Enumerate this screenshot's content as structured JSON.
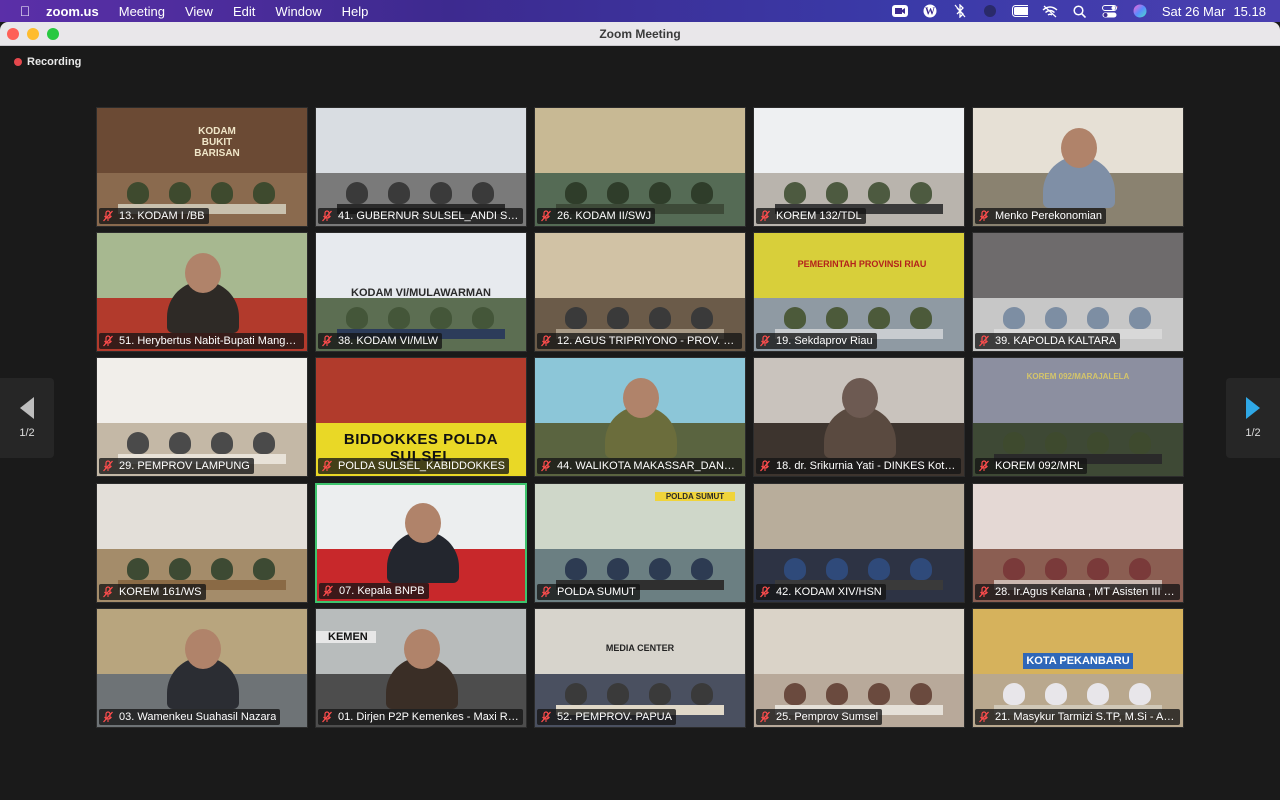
{
  "menubar": {
    "app_name": "zoom.us",
    "menus": [
      "Meeting",
      "View",
      "Edit",
      "Window",
      "Help"
    ],
    "date": "Sat 26 Mar",
    "time": "15.18",
    "icons": [
      "zoom-icon",
      "wordpress-icon",
      "bluetooth-off-icon",
      "status-icon",
      "battery-icon",
      "wifi-off-icon",
      "search-icon",
      "control-center-icon",
      "siri-icon"
    ]
  },
  "window": {
    "title": "Zoom Meeting"
  },
  "recording": {
    "label": "Recording"
  },
  "pager": {
    "left_label": "1/2",
    "right_label": "1/2"
  },
  "colors": {
    "active_speaker_border": "#3ec46d",
    "recording_dot": "#e5484d",
    "next_arrow": "#2fa8e6"
  },
  "participants": [
    {
      "name": "13. KODAM I /BB",
      "banner": "KODAM BUKIT BARISAN",
      "theme": "wood"
    },
    {
      "name": "41. GUBERNUR SULSEL_ANDI SUDI...",
      "banner": "",
      "theme": "flags"
    },
    {
      "name": "26. KODAM II/SWJ",
      "banner": "",
      "theme": "hall"
    },
    {
      "name": "KOREM 132/TDL",
      "banner": "",
      "theme": "white"
    },
    {
      "name": "Menko Perekonomian",
      "banner": "",
      "theme": "office"
    },
    {
      "name": "51. Herybertus Nabit-Bupati Mangg...",
      "banner": "",
      "theme": "green"
    },
    {
      "name": "38. KODAM VI/MLW",
      "banner": "KODAM VI/MULAWARMAN",
      "theme": "blue"
    },
    {
      "name": "12. AGUS TRIPRIYONO - PROV. SU...",
      "banner": "",
      "theme": "library"
    },
    {
      "name": "19. Sekdaprov Riau",
      "banner": "PEMERINTAH PROVINSI RIAU",
      "theme": "yellow"
    },
    {
      "name": "39. KAPOLDA KALTARA",
      "banner": "",
      "theme": "curtain"
    },
    {
      "name": "29. PEMPROV LAMPUNG",
      "banner": "",
      "theme": "bright"
    },
    {
      "name": "POLDA SULSEL_KABIDDOKKES",
      "banner": "BIDDOKKES POLDA SULSEL",
      "theme": "biddokkes"
    },
    {
      "name": "44. WALIKOTA MAKASSAR_DANNY...",
      "banner": "",
      "theme": "medical"
    },
    {
      "name": "18. dr. Srikurnia Yati - DINKES Kota...",
      "banner": "",
      "theme": "hijab"
    },
    {
      "name": "KOREM 092/MRL",
      "banner": "KOREM 092/MARAJALELA",
      "theme": "korem"
    },
    {
      "name": "KOREM 161/WS",
      "banner": "",
      "theme": "plain"
    },
    {
      "name": "07. Kepala BNPB",
      "banner": "",
      "theme": "bnpb"
    },
    {
      "name": "POLDA SUMUT",
      "banner": "POLDA SUMUT",
      "theme": "meeting"
    },
    {
      "name": "42. KODAM XIV/HSN",
      "banner": "",
      "theme": "conference"
    },
    {
      "name": "28. Ir.Agus Kelana , MT Asisten III P...",
      "banner": "",
      "theme": "ceiling"
    },
    {
      "name": "03. Wamenkeu Suahasil Nazara",
      "banner": "",
      "theme": "wamenkeu"
    },
    {
      "name": "01. Dirjen P2P Kemenkes - Maxi Ro...",
      "banner": "KEMEN",
      "theme": "outdoor"
    },
    {
      "name": "52. PEMPROV. PAPUA",
      "banner": "MEDIA CENTER",
      "theme": "papua"
    },
    {
      "name": "25. Pemprov Sumsel",
      "banner": "",
      "theme": "sumsel"
    },
    {
      "name": "21. Masykur Tarmizi S.TP, M.Si - Asi...",
      "banner": "KOTA PEKANBARU",
      "theme": "pekanbaru"
    }
  ]
}
